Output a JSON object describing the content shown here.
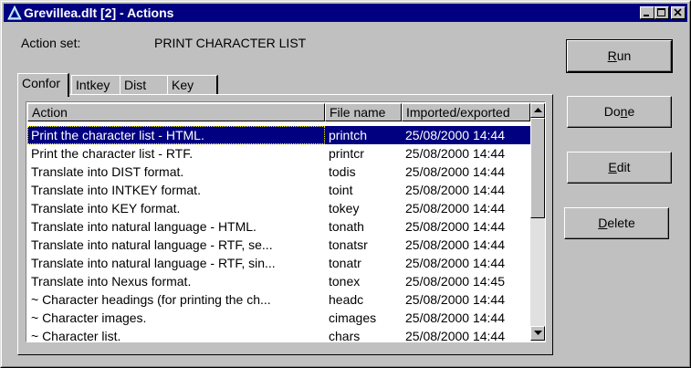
{
  "window": {
    "title": "Grevillea.dlt [2] - Actions",
    "titlebar_color": "#000080",
    "controls": [
      "minimize-icon",
      "maximize-icon",
      "close-icon"
    ]
  },
  "action_set": {
    "label": "Action set:",
    "value": "PRINT CHARACTER LIST"
  },
  "tabs": [
    {
      "label": "Confor",
      "active": true
    },
    {
      "label": "Intkey",
      "active": false
    },
    {
      "label": "Dist",
      "active": false
    },
    {
      "label": "Key",
      "active": false
    }
  ],
  "table": {
    "columns": [
      "Action",
      "File name",
      "Imported/exported"
    ],
    "rows": [
      {
        "action": "Print the character list - HTML.",
        "file": "printch",
        "date": "25/08/2000 14:44",
        "selected": true
      },
      {
        "action": "Print the character list - RTF.",
        "file": "printcr",
        "date": "25/08/2000 14:44"
      },
      {
        "action": "Translate into DIST format.",
        "file": "todis",
        "date": "25/08/2000 14:44"
      },
      {
        "action": "Translate into INTKEY format.",
        "file": "toint",
        "date": "25/08/2000 14:44"
      },
      {
        "action": "Translate into KEY format.",
        "file": "tokey",
        "date": "25/08/2000 14:44"
      },
      {
        "action": "Translate into natural language - HTML.",
        "file": "tonath",
        "date": "25/08/2000 14:44"
      },
      {
        "action": "Translate into natural language - RTF, se...",
        "file": "tonatsr",
        "date": "25/08/2000 14:44"
      },
      {
        "action": "Translate into natural language - RTF, sin...",
        "file": "tonatr",
        "date": "25/08/2000 14:44"
      },
      {
        "action": "Translate into Nexus format.",
        "file": "tonex",
        "date": "25/08/2000 14:45"
      },
      {
        "action": "~ Character headings (for printing the ch...",
        "file": "headc",
        "date": "25/08/2000 14:44"
      },
      {
        "action": "~ Character images.",
        "file": "cimages",
        "date": "25/08/2000 14:44"
      },
      {
        "action": "~ Character list.",
        "file": "chars",
        "date": "25/08/2000 14:44"
      }
    ]
  },
  "buttons": {
    "run": {
      "pre": "",
      "key": "R",
      "post": "un"
    },
    "done": {
      "pre": "Do",
      "key": "n",
      "post": "e"
    },
    "edit": {
      "pre": "",
      "key": "E",
      "post": "dit"
    },
    "delete": {
      "pre": "",
      "key": "D",
      "post": "elete"
    }
  }
}
